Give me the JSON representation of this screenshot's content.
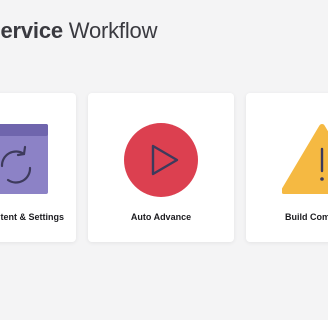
{
  "header": {
    "title_bold": "Service",
    "title_rest": " Workflow"
  },
  "cards": [
    {
      "label": "tent & Settings",
      "icon": "sync-window-icon"
    },
    {
      "label": "Auto Advance",
      "icon": "play-icon"
    },
    {
      "label": "Build Com",
      "icon": "warning-icon"
    }
  ],
  "colors": {
    "background": "#f4f4f5",
    "window_icon": "#8c82c6",
    "window_bar": "#6f65ad",
    "play_circle": "#dc4050",
    "warning": "#f5b942",
    "icon_stroke": "#3d3a5c"
  }
}
